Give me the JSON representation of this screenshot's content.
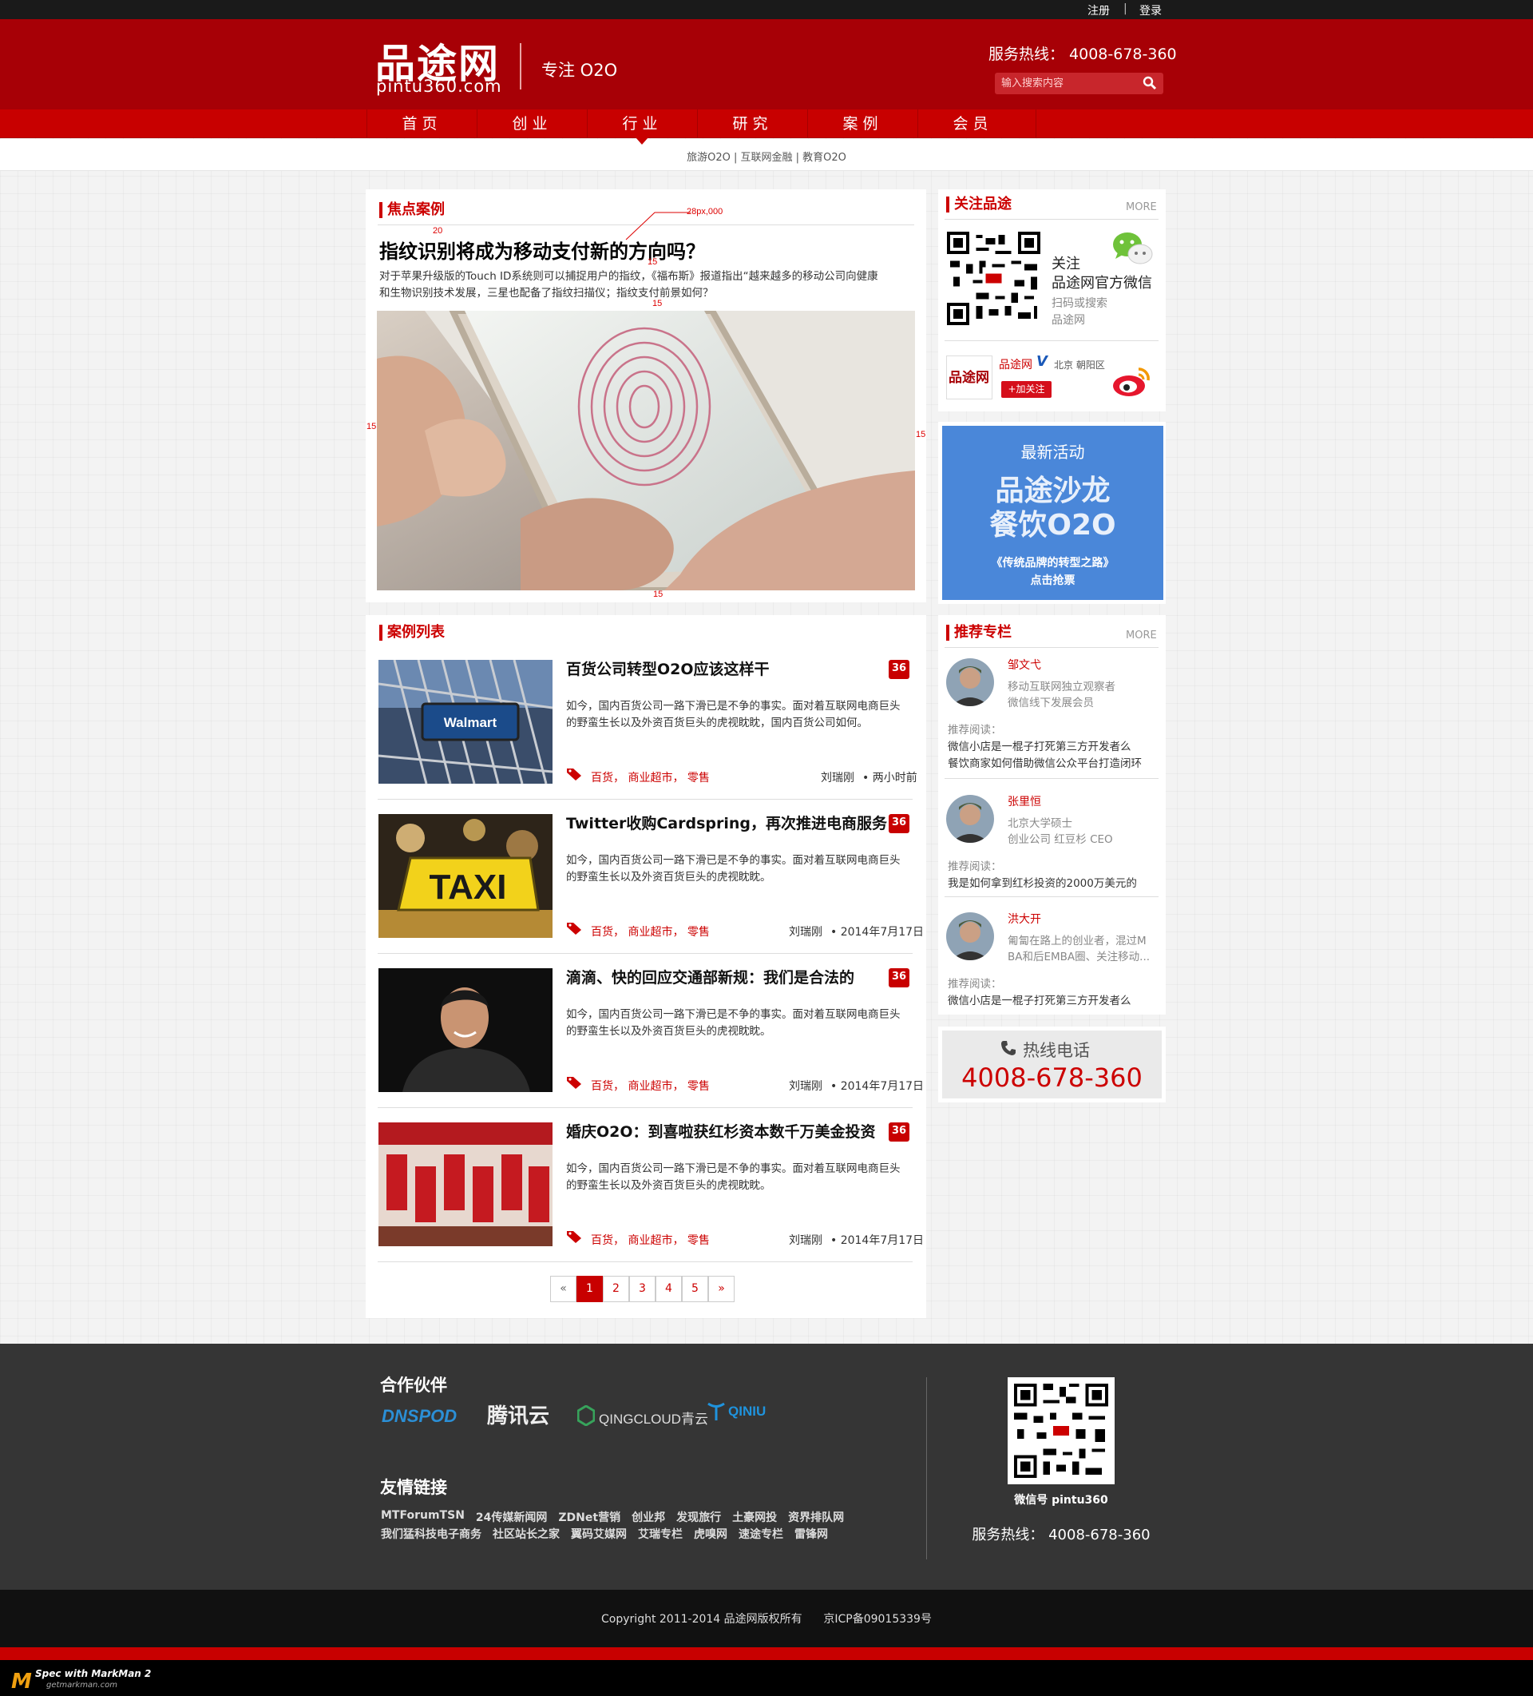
{
  "topbar": {
    "register": "注册",
    "sep": "|",
    "login": "登录"
  },
  "header": {
    "logo_main": "品途网",
    "logo_sub": "pintu360.com",
    "tagline": "专注 O2O",
    "hotline": "服务热线：  4008-678-360",
    "search_placeholder": "输入搜索内容"
  },
  "nav": {
    "items": [
      "首页",
      "创业",
      "行业",
      "研究",
      "案例",
      "会员"
    ]
  },
  "subnav": {
    "text": "旅游O2O  |  互联网金融  |  教育O2O"
  },
  "focus": {
    "section_title": "焦点案例",
    "headline": "指纹识别将成为移动支付新的方向吗？",
    "summary_line1": "对于苹果升级版的Touch ID系统则可以捕捉用户的指纹，《福布斯》报道指出“越来越多的移动公司向健康",
    "summary_line2": "和生物识别技术发展，三星也配备了指纹扫描仪；指纹支付前景如何？"
  },
  "annotations": {
    "a20": "20",
    "a15": "15",
    "afont": "28px,000"
  },
  "list": {
    "section_title": "案例列表",
    "items": [
      {
        "title": "百货公司转型O2O应该这样干",
        "count": "36",
        "desc1": "如今，国内百货公司一路下滑已是不争的事实。面对着互联网电商巨头",
        "desc2": "的野蛮生长以及外资百货巨头的虎视眈眈，国内百货公司如何。",
        "tags": "百货， 商业超市， 零售",
        "author": "刘瑞刚",
        "time": "• 两小时前",
        "image": "shopping-cart"
      },
      {
        "title": "Twitter收购Cardspring，再次推进电商服务",
        "count": "36",
        "desc1": "如今，国内百货公司一路下滑已是不争的事实。面对着互联网电商巨头",
        "desc2": "的野蛮生长以及外资百货巨头的虎视眈眈。",
        "tags": "百货， 商业超市， 零售",
        "author": "刘瑞刚",
        "time": "• 2014年7月17日",
        "image": "taxi"
      },
      {
        "title": "滴滴、快的回应交通部新规：我们是合法的",
        "count": "36",
        "desc1": "如今，国内百货公司一路下滑已是不争的事实。面对着互联网电商巨头",
        "desc2": "的野蛮生长以及外资百货巨头的虎视眈眈。",
        "tags": "百货， 商业超市， 零售",
        "author": "刘瑞刚",
        "time": "• 2014年7月17日",
        "image": "portrait"
      },
      {
        "title": "婚庆O2O：到喜啦获红杉资本数千万美金投资",
        "count": "36",
        "desc1": "如今，国内百货公司一路下滑已是不争的事实。面对着互联网电商巨头",
        "desc2": "的野蛮生长以及外资百货巨头的虎视眈眈。",
        "tags": "百货， 商业超市， 零售",
        "author": "刘瑞刚",
        "time": "• 2014年7月17日",
        "image": "wedding"
      }
    ]
  },
  "pagination": {
    "prev": "«",
    "pages": [
      "1",
      "2",
      "3",
      "4",
      "5"
    ],
    "next": "»",
    "current": "1"
  },
  "follow": {
    "title": "关注品途",
    "more": "MORE",
    "wx1": "关注",
    "wx2": "品途网官方微信",
    "wx3": "扫码或搜索",
    "wx4": "品途网",
    "wb_name": "品途网",
    "wb_v": "V",
    "wb_loc": "北京 朝阳区",
    "wb_btn": "+加关注",
    "wb_logo_text": "品途网"
  },
  "event": {
    "l1": "最新活动",
    "l2": "品途沙龙",
    "l3": "餐饮O2O",
    "l4": "《传统品牌的转型之路》",
    "l5": "点击抢票",
    "bg": "#4a87d9"
  },
  "columns": {
    "title": "推荐专栏",
    "more": "MORE",
    "rec_label": "推荐阅读：",
    "people": [
      {
        "name": "邹文弋",
        "d1": "移动互联网独立观察者",
        "d2": "微信线下发展会员",
        "reads": [
          "微信小店是一棍子打死第三方开发者么",
          "餐饮商家如何借助微信公众平台打造闭环"
        ]
      },
      {
        "name": "张里恒",
        "d1": "北京大学硕士",
        "d2": "创业公司 红豆杉 CEO",
        "reads": [
          "我是如何拿到红杉投资的2000万美元的"
        ]
      },
      {
        "name": "洪大开",
        "d1": "匍匐在路上的创业者，混过M",
        "d2": "BA和后EMBA圈、关注移动...",
        "reads": [
          "微信小店是一棍子打死第三方开发者么"
        ]
      }
    ]
  },
  "hotline_box": {
    "label": "热线电话",
    "number": "4008-678-360"
  },
  "footer": {
    "partners_title": "合作伙伴",
    "partners": [
      "DNSPOD",
      "腾讯云",
      "QINGCLOUD青云",
      "QINIU"
    ],
    "links_title": "友情链接",
    "links_row1": [
      "MTForumTSN",
      "24传媒新闻网",
      "ZDNet营销",
      "创业邦",
      "发现旅行",
      "土豪网投",
      "资界排队网"
    ],
    "links_row2": [
      "我们猛科技电子商务",
      "社区站长之家",
      "翼码艾媒网",
      "艾瑞专栏",
      "虎嗅网",
      "速途专栏",
      "雷锋网"
    ],
    "wechat": "微信号 pintu360",
    "hotline": "服务热线：  4008-678-360",
    "copyright": "Copyright 2011-2014 品途网版权所有      京ICP备09015339号"
  },
  "markman": {
    "l1": "Spec with MarkMan 2",
    "l2": "getmarkman.com"
  },
  "colors": {
    "brand_red": "#c80000",
    "header_red": "#a70006",
    "footer_dark": "#353535"
  }
}
